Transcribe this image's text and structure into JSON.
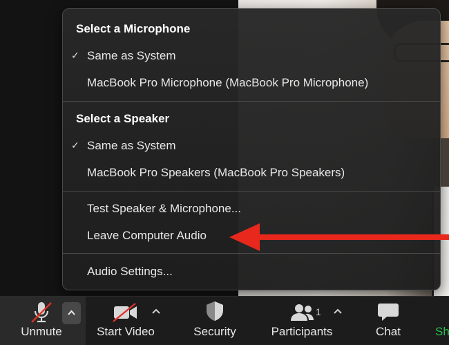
{
  "menu": {
    "microphone_heading": "Select a Microphone",
    "microphone_options": [
      "Same as System",
      "MacBook Pro Microphone (MacBook Pro Microphone)"
    ],
    "speaker_heading": "Select a Speaker",
    "speaker_options": [
      "Same as System",
      "MacBook Pro Speakers (MacBook Pro Speakers)"
    ],
    "test_audio": "Test Speaker & Microphone...",
    "leave_audio": "Leave Computer Audio",
    "audio_settings": "Audio Settings...",
    "check_glyph": "✓"
  },
  "toolbar": {
    "unmute": "Unmute",
    "start_video": "Start Video",
    "security": "Security",
    "participants": "Participants",
    "participants_count": "1",
    "chat": "Chat",
    "share_partial": "Sh",
    "caret_glyph": "^"
  },
  "colors": {
    "arrow": "#e8281c",
    "share_green": "#27c24c",
    "muted_slash": "#e0302a"
  }
}
